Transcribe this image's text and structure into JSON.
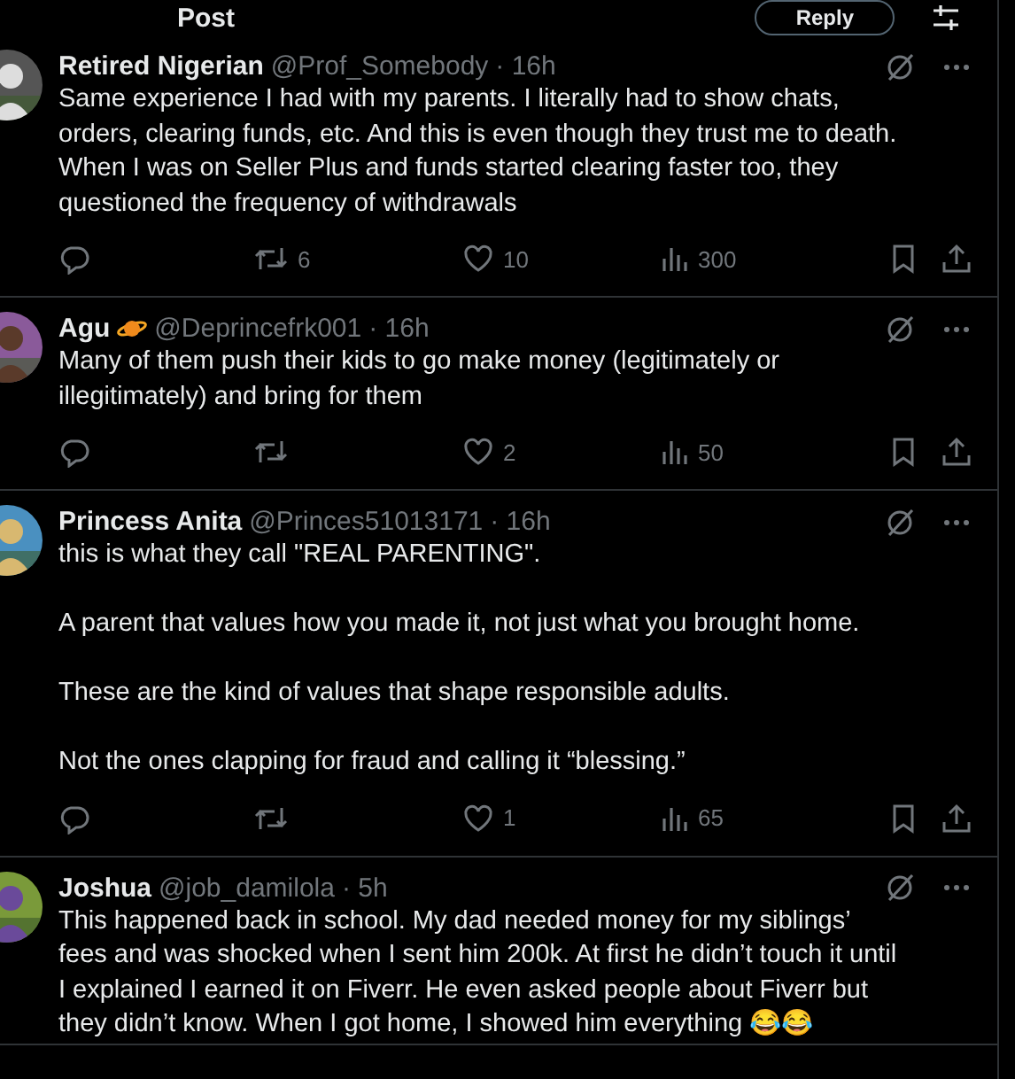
{
  "header": {
    "title": "Post",
    "reply_button": "Reply"
  },
  "replies": [
    {
      "name": "Retired Nigerian",
      "badge": false,
      "handle": "@Prof_Somebody",
      "time": "· 16h",
      "text": "Same experience I had with my parents. I literally had to show chats, orders, clearing funds, etc. And this is even though they trust me to death. When I was on Seller Plus and funds started clearing faster too, they questioned the frequency of withdrawals",
      "actions": {
        "reposts": "6",
        "likes": "10",
        "views": "300"
      }
    },
    {
      "name": "Agu",
      "badge": true,
      "handle": "@Deprincefrk001",
      "time": "· 16h",
      "text": "Many of them push their kids to go make money (legitimately or illegitimately) and bring for them",
      "actions": {
        "likes": "2",
        "views": "50"
      }
    },
    {
      "name": "Princess Anita",
      "badge": false,
      "handle": "@Princes51013171",
      "time": "· 16h",
      "text": "this is what they call \"REAL PARENTING\".\n\nA parent that values how you made it, not just what you brought home.\n\nThese are the kind of values that shape responsible adults.\n\nNot the ones clapping for fraud and calling it “blessing.”",
      "actions": {
        "likes": "1",
        "views": "65"
      }
    },
    {
      "name": "Joshua",
      "badge": false,
      "handle": "@job_damilola",
      "time": "· 5h",
      "text": "This happened back in school. My dad needed money for my siblings’ fees and was shocked when I sent him 200k. At first he didn’t touch it until I explained I earned it on Fiverr. He even asked people about Fiverr but they didn’t know. When I got home, I showed him everything 😂😂"
    }
  ]
}
